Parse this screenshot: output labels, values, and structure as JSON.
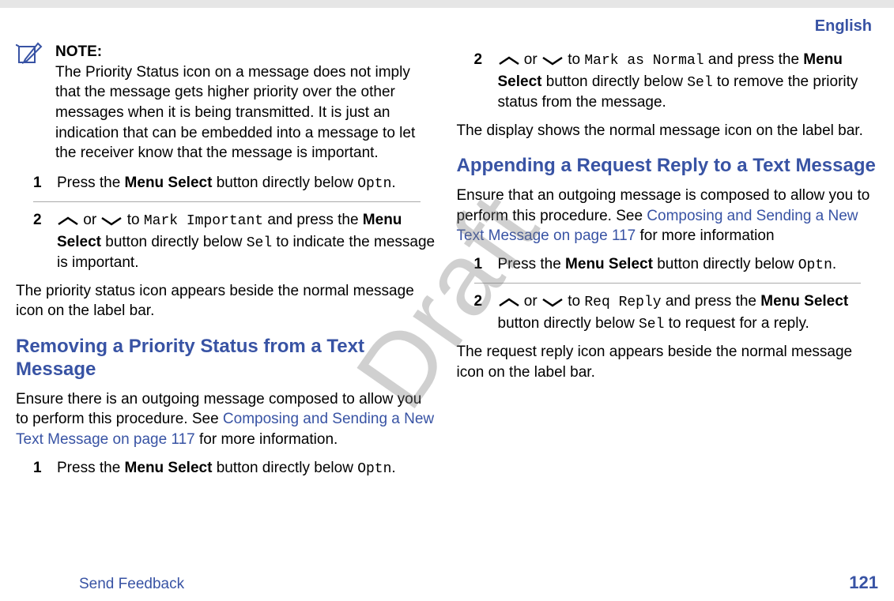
{
  "header": {
    "language": "English"
  },
  "watermark": "Draft",
  "footer": {
    "send_feedback": "Send Feedback",
    "page_number": "121"
  },
  "left": {
    "note": {
      "title": "NOTE:",
      "body": "The Priority Status icon on a message does not imply that the message gets higher priority over the other messages when it is being transmitted. It is just an indication that can be embedded into a message to let the receiver know that the message is important."
    },
    "stepsA": {
      "s1": {
        "num": "1",
        "pre": "Press the ",
        "b1": "Menu Select",
        "mid": " button directly below ",
        "mono": "Optn",
        "post": "."
      },
      "s2": {
        "num": "2",
        "a1": " or ",
        "a2": " to ",
        "mono1": "Mark Important",
        "mid1": " and press the ",
        "b1": "Menu Select",
        "mid2": " button directly below ",
        "mono2": "Sel",
        "mid3": " to indicate the message is important."
      }
    },
    "para1": "The priority status icon appears beside the normal message icon on the label bar.",
    "heading1": "Removing a Priority Status from a Text Message",
    "para2a": "Ensure there is an outgoing message composed to allow you to perform this procedure. See ",
    "link1": "Composing and Sending a New Text Message on page 117",
    "para2b": " for more information.",
    "stepsB": {
      "s1": {
        "num": "1",
        "pre": "Press the ",
        "b1": "Menu Select",
        "mid": " button directly below ",
        "mono": "Optn",
        "post": "."
      }
    }
  },
  "right": {
    "stepsC": {
      "s2": {
        "num": "2",
        "a1": " or ",
        "a2": " to ",
        "mono1": "Mark as Normal",
        "mid1": " and press the ",
        "b1": "Menu Select",
        "mid2": " button directly below ",
        "mono2": "Sel",
        "mid3": " to remove the priority status from the message."
      }
    },
    "para1": "The display shows the normal message icon on the label bar.",
    "heading1": "Appending a Request Reply to a Text Message",
    "para2a": "Ensure that an outgoing message is composed to allow you to perform this procedure. See ",
    "link1": "Composing and Sending a New Text Message on page 117",
    "para2b": " for more information",
    "stepsD": {
      "s1": {
        "num": "1",
        "pre": "Press the ",
        "b1": "Menu Select",
        "mid": " button directly below ",
        "mono": "Optn",
        "post": "."
      },
      "s2": {
        "num": "2",
        "a1": " or ",
        "a2": " to ",
        "mono1": "Req Reply",
        "mid1": " and press the ",
        "b1": "Menu Select",
        "mid2": " button directly below ",
        "mono2": "Sel",
        "mid3": " to request for a reply."
      }
    },
    "para3": "The request reply icon appears beside the normal message icon on the label bar."
  }
}
